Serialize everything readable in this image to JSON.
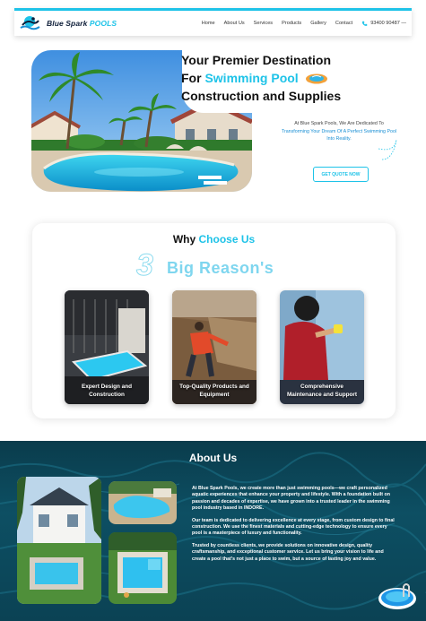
{
  "brand": {
    "name_dark": "Blue Spark",
    "name_accent": "POOLS"
  },
  "nav": {
    "items": [
      "Home",
      "About Us",
      "Services",
      "Products",
      "Gallery",
      "Contact"
    ],
    "phone": "93400 90487 —"
  },
  "hero": {
    "title_line1": "Your Premier Destination",
    "title_for": "For",
    "title_accent": "Swimming Pool",
    "title_line3": "Construction and Supplies",
    "desc_pre": "At Blue Spark Pools, We Are Dedicated To",
    "desc_highlight": "Transforming Your Dream Of A Perfect Swimming Pool Into Reality.",
    "cta": "GET QUOTE NOW"
  },
  "why": {
    "title_plain": "Why",
    "title_accent": "Choose Us",
    "big_number": "3",
    "big_label": "Big Reason's",
    "reasons": [
      "Expert Design and Construction",
      "Top-Quality Products and Equipment",
      "Comprehensive Maintenance and Support"
    ]
  },
  "about": {
    "title": "About Us",
    "paragraphs": [
      "At Blue Spark Pools, we create more than just swimming pools—we craft personalized aquatic experiences that enhance your property and lifestyle. With a foundation built on passion and decades of expertise, we have grown into a trusted leader in the swimming pool industry based in INDORE.",
      "Our team is dedicated to delivering excellence at every stage, from custom design to final construction. We use the finest materials and cutting-edge technology to ensure every pool is a masterpiece of luxury and functionality.",
      "Trusted by countless clients, we provide solutions on innovative design, quality craftsmanship, and exceptional customer service. Let us bring your vision to life and create a pool that's not just a place to swim, but a source of lasting joy and value."
    ]
  },
  "colors": {
    "accent": "#1ec3e8",
    "navy": "#0f1f3a",
    "about_bg": "#0d4f63"
  },
  "icons": [
    "logo-swimmer-icon",
    "phone-icon",
    "pool-float-icon"
  ]
}
